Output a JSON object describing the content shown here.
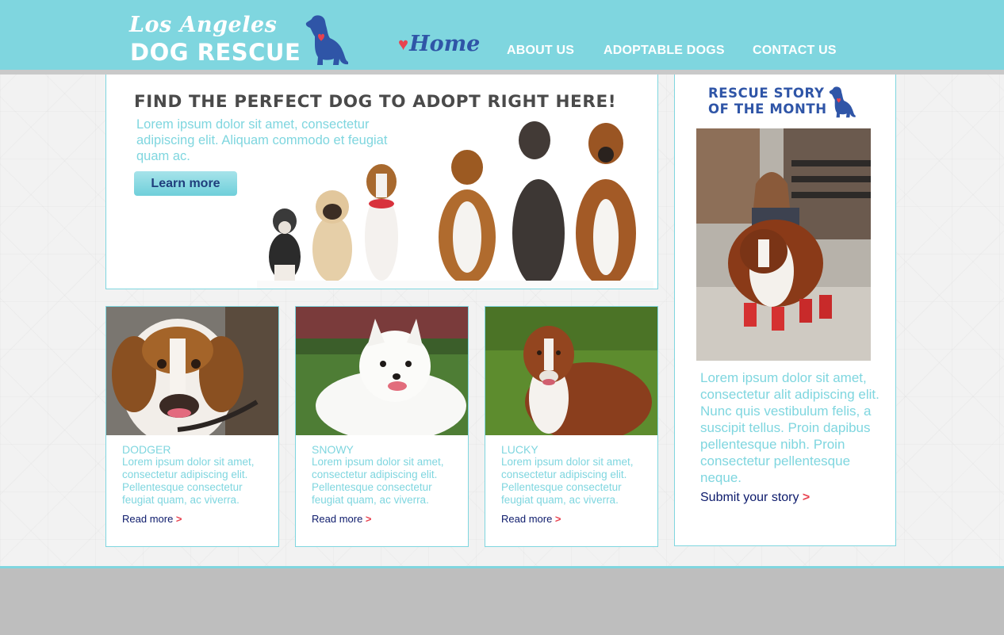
{
  "colors": {
    "accent": "#7fd6df",
    "navy": "#2f55a7",
    "heart": "#e8424f",
    "link": "#0c1a6b",
    "footer": "#bebebe"
  },
  "logo": {
    "script": "Los Angeles",
    "main": "DOG RESCUE",
    "icon": "dog-heart-icon"
  },
  "nav": {
    "home": "Home",
    "items": [
      "ABOUT US",
      "ADOPTABLE DOGS",
      "CONTACT US"
    ]
  },
  "hero": {
    "title": "FIND THE PERFECT DOG TO ADOPT RIGHT HERE!",
    "text": "Lorem ipsum dolor sit amet, consectetur adipiscing elit. Aliquam commodo et feugiat quam ac.",
    "button": "Learn more"
  },
  "dogs": [
    {
      "name": "DODGER",
      "text": "Lorem ipsum dolor sit amet, consectetur adipiscing elit. Pellentesque consectetur feugiat quam, ac viverra.",
      "link": "Read more"
    },
    {
      "name": "SNOWY",
      "text": "Lorem ipsum dolor sit amet, consectetur adipiscing elit. Pellentesque consectetur feugiat quam, ac viverra.",
      "link": "Read more"
    },
    {
      "name": "LUCKY",
      "text": "Lorem ipsum dolor sit amet, consectetur adipiscing elit. Pellentesque consectetur feugiat quam, ac viverra.",
      "link": "Read more"
    }
  ],
  "sidebar": {
    "title_line1": "RESCUE STORY",
    "title_line2": "OF THE MONTH",
    "text": "Lorem ipsum dolor sit amet, consectetur alit adipiscing elit. Nunc quis vestibulum felis, a suscipit tellus. Proin dapibus pellentesque nibh. Proin consectetur pellentesque neque.",
    "link": "Submit your story"
  }
}
